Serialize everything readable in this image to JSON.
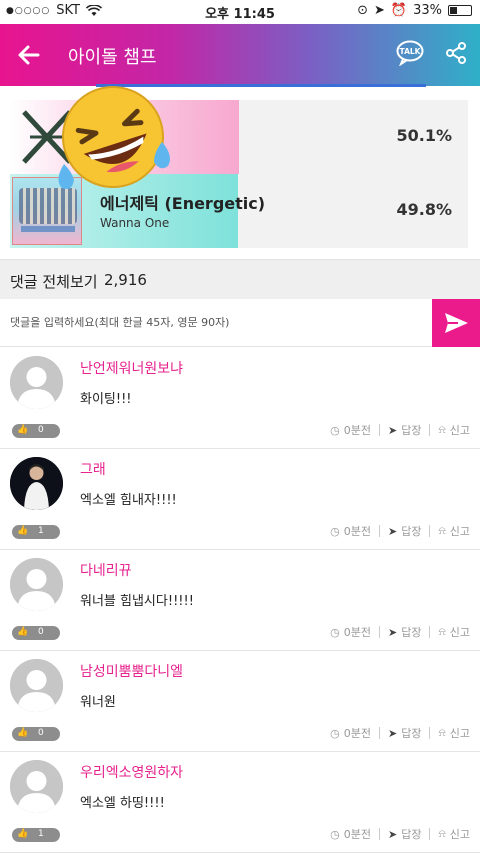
{
  "status_bar": {
    "carrier": "SKT",
    "time": "오후 11:45",
    "battery": "33%"
  },
  "header": {
    "title": "아이돌 챔프",
    "talk_label": "TALK"
  },
  "vote": {
    "items": [
      {
        "title": "",
        "artist": "",
        "percent": "50.1%",
        "bar_fill": 0.501
      },
      {
        "title": "에너제틱 (Energetic)",
        "artist": "Wanna One",
        "percent": "49.8%",
        "bar_fill": 0.498
      }
    ]
  },
  "comments_header": {
    "label": "댓글 전체보기",
    "count": "2,916"
  },
  "input": {
    "placeholder": "댓글을 입력하세요(최대 한글 45자, 영문 90자)"
  },
  "comment_labels": {
    "time": "0분전",
    "reply": "답장",
    "report": "신고"
  },
  "comments": [
    {
      "nickname": "난언제워너원보냐",
      "text": "화이팅!!!",
      "likes": "0",
      "avatar": "default"
    },
    {
      "nickname": "그래",
      "text": "엑소엘 힘내자!!!!",
      "likes": "1",
      "avatar": "photo"
    },
    {
      "nickname": "다네리뀨",
      "text": "워너블 힘냅시다!!!!!",
      "likes": "0",
      "avatar": "default"
    },
    {
      "nickname": "남성미뿜뿜다니엘",
      "text": "워너원",
      "likes": "0",
      "avatar": "default"
    },
    {
      "nickname": "우리엑소영원하자",
      "text": "엑소엘 하띵!!!!",
      "likes": "1",
      "avatar": "default"
    }
  ],
  "colors": {
    "accent": "#ec1b8c",
    "nickname": "#e6238e",
    "bar_pink": "#f7a8cf",
    "bar_teal": "#7ee2da"
  }
}
